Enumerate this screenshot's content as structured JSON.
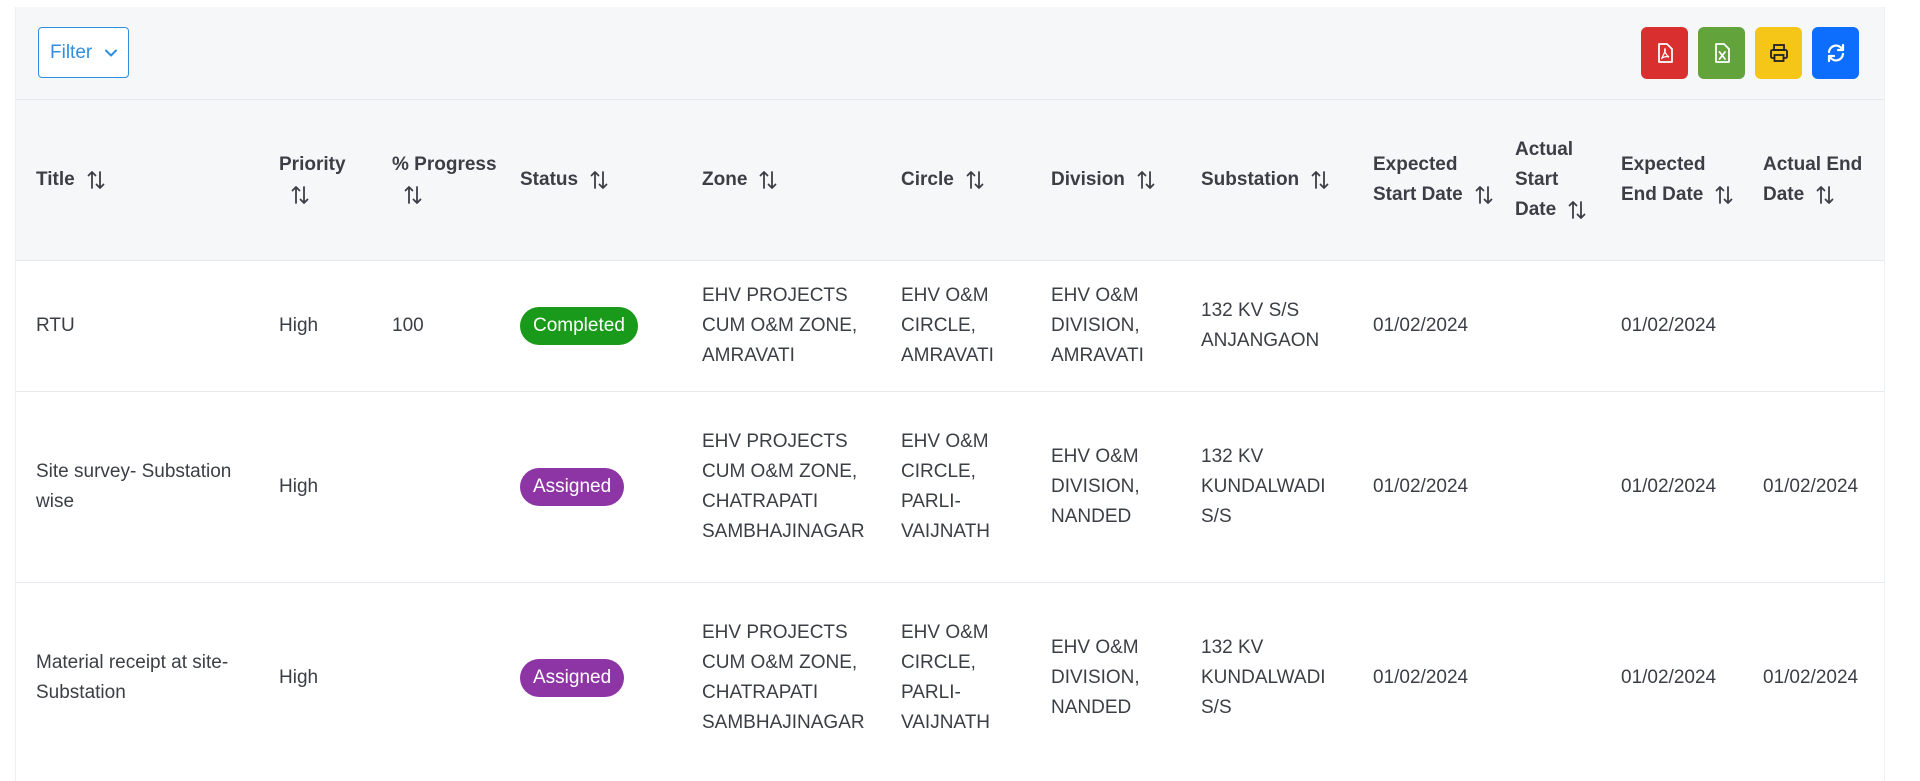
{
  "toolbar": {
    "filter_label": "Filter",
    "tools": [
      {
        "name": "pdf-export",
        "icon": "file-pdf-icon",
        "color": "#d9302f"
      },
      {
        "name": "excel-export",
        "icon": "file-excel-icon",
        "color": "#63a33b"
      },
      {
        "name": "print",
        "icon": "printer-icon",
        "color": "#f5c518"
      },
      {
        "name": "refresh",
        "icon": "refresh-icon",
        "color": "#0d6efd"
      }
    ]
  },
  "table": {
    "headers": [
      {
        "key": "title",
        "label": "Title"
      },
      {
        "key": "priority",
        "label": "Priority"
      },
      {
        "key": "progress",
        "label": "% Progress"
      },
      {
        "key": "status",
        "label": "Status"
      },
      {
        "key": "zone",
        "label": "Zone"
      },
      {
        "key": "circle",
        "label": "Circle"
      },
      {
        "key": "division",
        "label": "Division"
      },
      {
        "key": "substation",
        "label": "Substation"
      },
      {
        "key": "exp_start",
        "label": "Expected Start Date"
      },
      {
        "key": "act_start",
        "label": "Actual Start Date"
      },
      {
        "key": "exp_end",
        "label": "Expected End Date"
      },
      {
        "key": "act_end",
        "label": "Actual End Date"
      }
    ],
    "rows": [
      {
        "title": "RTU",
        "priority": "High",
        "progress": "100",
        "status": "Completed",
        "status_color": "#1a9a1a",
        "zone": "EHV PROJECTS CUM O&M ZONE, AMRAVATI",
        "circle": "EHV O&M CIRCLE, AMRAVATI",
        "division": "EHV O&M DIVISION, AMRAVATI",
        "substation": "132 KV S/S ANJANGAON",
        "exp_start": "01/02/2024",
        "act_start": "",
        "exp_end": "01/02/2024",
        "act_end": ""
      },
      {
        "title": "Site survey- Substation wise",
        "priority": "High",
        "progress": "",
        "status": "Assigned",
        "status_color": "#8e35a6",
        "zone": "EHV PROJECTS CUM O&M ZONE, CHATRAPATI SAMBHAJINAGAR",
        "circle": "EHV O&M CIRCLE, PARLI-VAIJNATH",
        "division": "EHV O&M DIVISION, NANDED",
        "substation": "132 KV KUNDALWADI S/S",
        "exp_start": "01/02/2024",
        "act_start": "",
        "exp_end": "01/02/2024",
        "act_end": "01/02/2024"
      },
      {
        "title": "Material receipt at site-Substation",
        "priority": "High",
        "progress": "",
        "status": "Assigned",
        "status_color": "#8e35a6",
        "zone": "EHV PROJECTS CUM O&M ZONE, CHATRAPATI SAMBHAJINAGAR",
        "circle": "EHV O&M CIRCLE, PARLI-VAIJNATH",
        "division": "EHV O&M DIVISION, NANDED",
        "substation": "132 KV KUNDALWADI S/S",
        "exp_start": "01/02/2024",
        "act_start": "",
        "exp_end": "01/02/2024",
        "act_end": "01/02/2024"
      }
    ]
  }
}
